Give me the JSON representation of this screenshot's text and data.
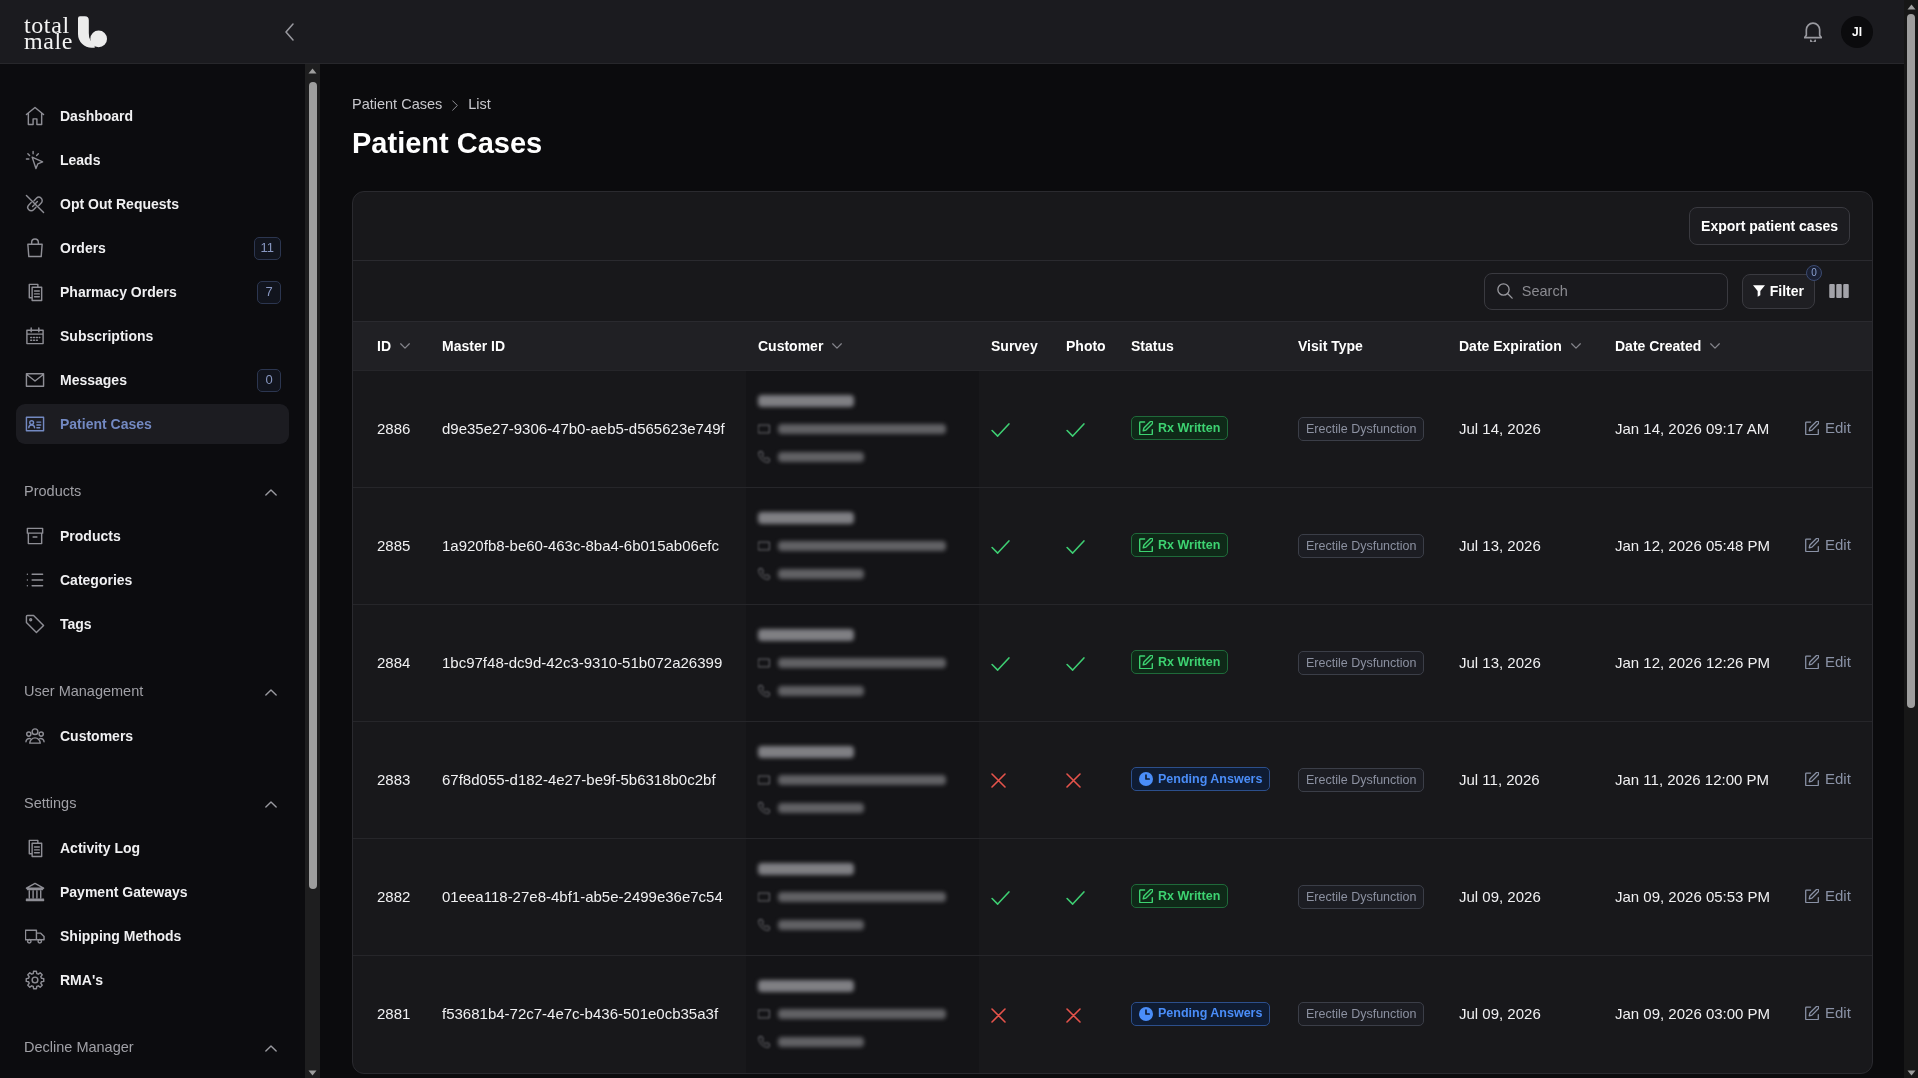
{
  "topbar": {
    "logo": [
      "total",
      "male"
    ],
    "avatar_initials": "JI"
  },
  "sidebar": {
    "items": [
      {
        "label": "Dashboard",
        "selected": false
      },
      {
        "label": "Leads",
        "selected": false
      },
      {
        "label": "Opt Out Requests",
        "selected": false
      },
      {
        "label": "Orders",
        "badge": "11",
        "selected": false
      },
      {
        "label": "Pharmacy Orders",
        "badge": "7",
        "selected": false
      },
      {
        "label": "Subscriptions",
        "selected": false
      },
      {
        "label": "Messages",
        "badge": "0",
        "selected": false
      },
      {
        "label": "Patient Cases",
        "selected": true
      }
    ],
    "groups": [
      {
        "title": "Products",
        "expanded": true,
        "items": [
          {
            "label": "Products",
            "selected": false
          },
          {
            "label": "Categories",
            "selected": false
          },
          {
            "label": "Tags",
            "selected": false
          }
        ]
      },
      {
        "title": "User Management",
        "expanded": true,
        "items": [
          {
            "label": "Customers",
            "selected": false
          }
        ]
      },
      {
        "title": "Settings",
        "expanded": true,
        "items": [
          {
            "label": "Activity Log",
            "selected": false
          },
          {
            "label": "Payment Gateways",
            "selected": false
          },
          {
            "label": "Shipping Methods",
            "selected": false
          },
          {
            "label": "RMA's",
            "selected": false
          }
        ]
      },
      {
        "title": "Decline Manager",
        "expanded": true
      }
    ]
  },
  "breadcrumbs": [
    "Patient Cases",
    "List"
  ],
  "page_title": "Patient Cases",
  "export_button": "Export patient cases",
  "search": {
    "placeholder": "Search"
  },
  "filter_button": {
    "label": "Filter",
    "count": "0"
  },
  "table": {
    "columns": [
      {
        "label": "ID",
        "sortable": true
      },
      {
        "label": "Master ID",
        "sortable": false
      },
      {
        "label": "Customer",
        "sortable": true
      },
      {
        "label": "Survey",
        "sortable": false
      },
      {
        "label": "Photo",
        "sortable": false
      },
      {
        "label": "Status",
        "sortable": false
      },
      {
        "label": "Visit Type",
        "sortable": false
      },
      {
        "label": "Date Expiration",
        "sortable": true
      },
      {
        "label": "Date Created",
        "sortable": true
      }
    ],
    "rows": [
      {
        "id": "2886",
        "master_id": "d9e35e27-9306-47b0-aeb5-d565623e749f",
        "survey": true,
        "photo": true,
        "status": {
          "label": "Rx Written",
          "kind": "rx_written"
        },
        "visit_type": "Erectile Dysfunction",
        "date_expiration": "Jul 14, 2026",
        "date_created": "Jan 14, 2026 09:17 AM",
        "action": "Edit"
      },
      {
        "id": "2885",
        "master_id": "1a920fb8-be60-463c-8ba4-6b015ab06efc",
        "survey": true,
        "photo": true,
        "status": {
          "label": "Rx Written",
          "kind": "rx_written"
        },
        "visit_type": "Erectile Dysfunction",
        "date_expiration": "Jul 13, 2026",
        "date_created": "Jan 12, 2026 05:48 PM",
        "action": "Edit"
      },
      {
        "id": "2884",
        "master_id": "1bc97f48-dc9d-42c3-9310-51b072a26399",
        "survey": true,
        "photo": true,
        "status": {
          "label": "Rx Written",
          "kind": "rx_written"
        },
        "visit_type": "Erectile Dysfunction",
        "date_expiration": "Jul 13, 2026",
        "date_created": "Jan 12, 2026 12:26 PM",
        "action": "Edit"
      },
      {
        "id": "2883",
        "master_id": "67f8d055-d182-4e27-be9f-5b6318b0c2bf",
        "survey": false,
        "photo": false,
        "status": {
          "label": "Pending Answers",
          "kind": "pending_answers"
        },
        "visit_type": "Erectile Dysfunction",
        "date_expiration": "Jul 11, 2026",
        "date_created": "Jan 11, 2026 12:00 PM",
        "action": "Edit"
      },
      {
        "id": "2882",
        "master_id": "01eea118-27e8-4bf1-ab5e-2499e36e7c54",
        "survey": true,
        "photo": true,
        "status": {
          "label": "Rx Written",
          "kind": "rx_written"
        },
        "visit_type": "Erectile Dysfunction",
        "date_expiration": "Jul 09, 2026",
        "date_created": "Jan 09, 2026 05:53 PM",
        "action": "Edit"
      },
      {
        "id": "2881",
        "master_id": "f53681b4-72c7-4e7c-b436-501e0cb35a3f",
        "survey": false,
        "photo": false,
        "status": {
          "label": "Pending Answers",
          "kind": "pending_answers"
        },
        "visit_type": "Erectile Dysfunction",
        "date_expiration": "Jul 09, 2026",
        "date_created": "Jan 09, 2026 03:00 PM",
        "action": "Edit"
      }
    ]
  }
}
